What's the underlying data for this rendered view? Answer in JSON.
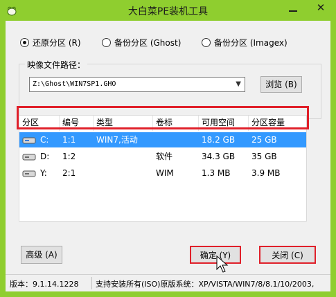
{
  "window": {
    "title": "大白菜PE装机工具",
    "close_symbol": "✕"
  },
  "options": [
    {
      "label": "还原分区 (R)",
      "checked": true
    },
    {
      "label": "备份分区 (Ghost)",
      "checked": false
    },
    {
      "label": "备份分区 (Imagex)",
      "checked": false
    }
  ],
  "image_path": {
    "label": "映像文件路径：",
    "value": "Z:\\Ghost\\WIN7SP1.GHO",
    "arrow": "▼",
    "browse_label": "浏览 (B)"
  },
  "table": {
    "headers": [
      "分区",
      "编号",
      "类型",
      "卷标",
      "可用空间",
      "分区容量"
    ],
    "rows": [
      {
        "drive": "C:",
        "number": "1:1",
        "type": "WIN7,活动",
        "label": "",
        "free": "18.2 GB",
        "size": "25 GB",
        "selected": true
      },
      {
        "drive": "D:",
        "number": "1:2",
        "type": "",
        "label": "软件",
        "free": "34.3 GB",
        "size": "35 GB",
        "selected": false
      },
      {
        "drive": "Y:",
        "number": "2:1",
        "type": "",
        "label": "WIM",
        "free": "1.3 MB",
        "size": "3.9 MB",
        "selected": false
      }
    ]
  },
  "buttons": {
    "advanced": "高级 (A)",
    "confirm": "确定 (Y)",
    "close": "关闭 (C)"
  },
  "status": {
    "version": "版本：9.1.14.1228",
    "support": "支持安装所有(ISO)原版系统：XP/VISTA/WIN7/8/8.1/10/2003,"
  },
  "colors": {
    "frame": "#8fce2f",
    "selection": "#3399ff",
    "highlight": "#e0202a"
  }
}
